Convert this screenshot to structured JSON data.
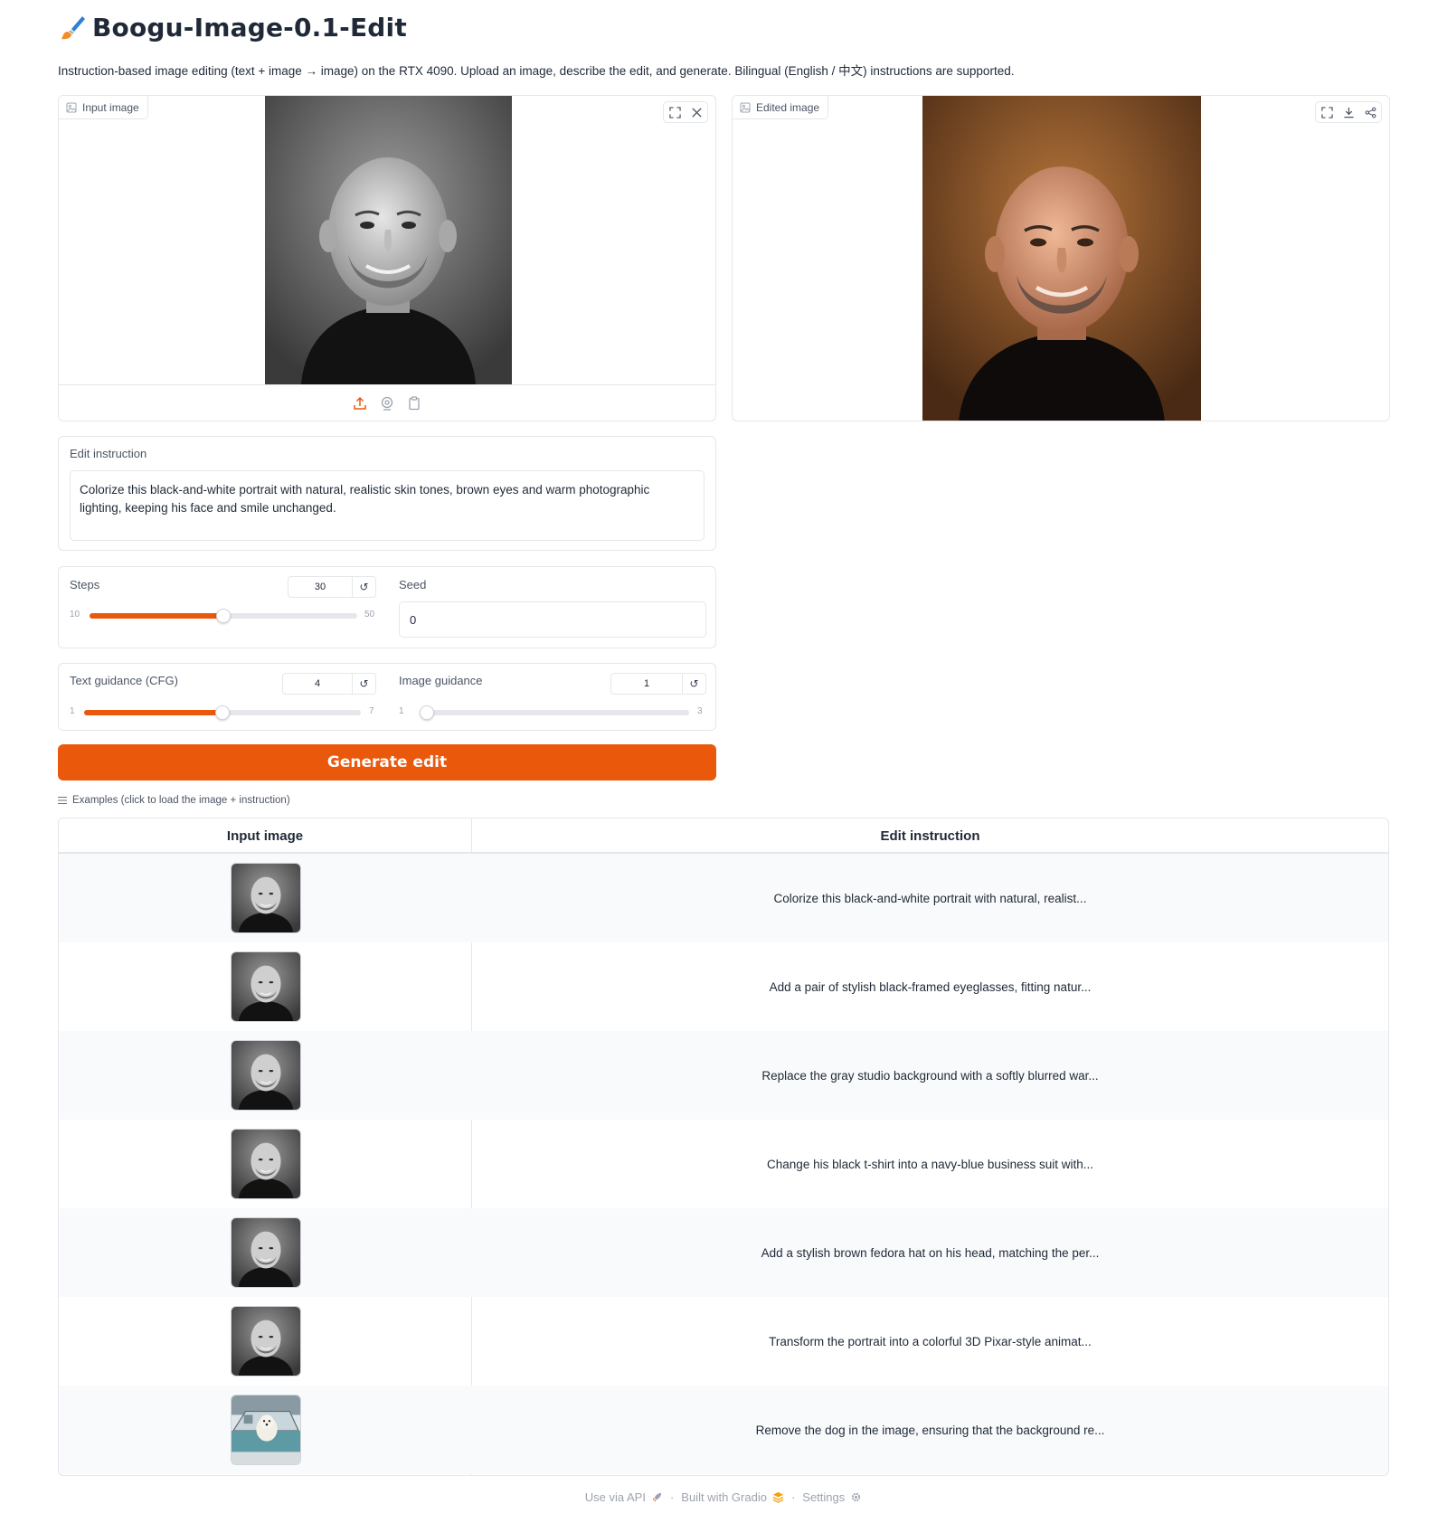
{
  "header": {
    "title": "Boogu-Image-0.1-Edit",
    "title_icon": "paintbrush-icon",
    "subtitle": "Instruction-based image editing (text + image → image) on the RTX 4090. Upload an image, describe the edit, and generate. Bilingual (English / 中文) instructions are supported."
  },
  "input_panel": {
    "label": "Input image",
    "tools": [
      "fullscreen-icon",
      "close-icon"
    ],
    "upload_sources": [
      "upload-icon",
      "webcam-icon",
      "clipboard-icon"
    ]
  },
  "output_panel": {
    "label": "Edited image",
    "tools": [
      "fullscreen-icon",
      "download-icon",
      "share-icon"
    ]
  },
  "edit_instruction": {
    "label": "Edit instruction",
    "value": "Colorize this black-and-white portrait with natural, realistic skin tones, brown eyes and warm photographic lighting, keeping his face and smile unchanged."
  },
  "steps": {
    "label": "Steps",
    "value": "30",
    "min": "10",
    "max": "50",
    "fraction": 0.5
  },
  "seed": {
    "label": "Seed",
    "value": "0"
  },
  "text_guidance": {
    "label": "Text guidance (CFG)",
    "value": "4",
    "min": "1",
    "max": "7",
    "fraction": 0.5
  },
  "image_guidance": {
    "label": "Image guidance",
    "value": "1",
    "min": "1",
    "max": "3",
    "fraction": 0.0
  },
  "generate_button": {
    "label": "Generate edit",
    "color": "#ea580c"
  },
  "examples": {
    "label": "Examples (click to load the image + instruction)",
    "headers": [
      "Input image",
      "Edit instruction"
    ],
    "rows": [
      {
        "image": "portrait-bw",
        "text": "Colorize this black-and-white portrait with natural, realist..."
      },
      {
        "image": "portrait-bw",
        "text": "Add a pair of stylish black-framed eyeglasses, fitting natur..."
      },
      {
        "image": "portrait-bw",
        "text": "Replace the gray studio background with a softly blurred war..."
      },
      {
        "image": "portrait-bw",
        "text": "Change his black t-shirt into a navy-blue business suit with..."
      },
      {
        "image": "portrait-bw",
        "text": "Add a stylish brown fedora hat on his head, matching the per..."
      },
      {
        "image": "portrait-bw",
        "text": "Transform the portrait into a colorful 3D Pixar-style animat..."
      },
      {
        "image": "dog-in-car",
        "text": "Remove the dog in the image, ensuring that the background re..."
      }
    ]
  },
  "footer": {
    "api": "Use via API",
    "gradio": "Built with Gradio",
    "settings": "Settings",
    "separator": "·"
  }
}
